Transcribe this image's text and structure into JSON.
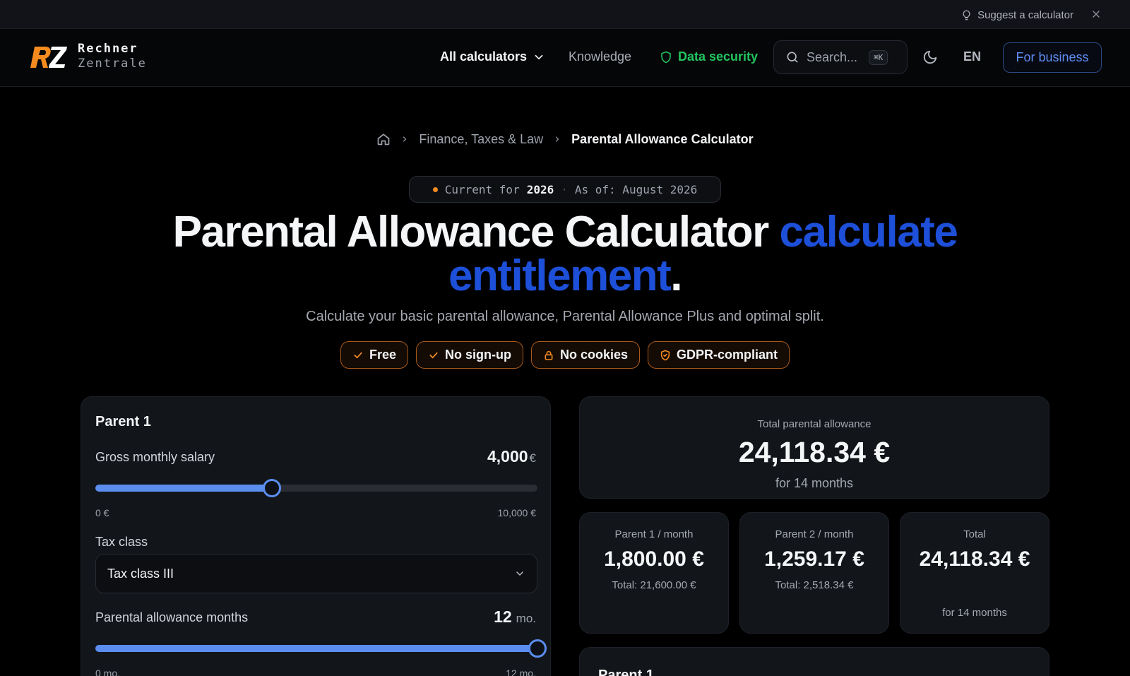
{
  "topbar": {
    "suggest_label": "Suggest a calculator"
  },
  "header": {
    "logo_line1": "Rechner",
    "logo_line2": "Zentrale",
    "nav": {
      "all_calculators": "All calculators",
      "knowledge": "Knowledge",
      "data_security": "Data security"
    },
    "search_placeholder": "Search...",
    "search_shortcut": "⌘K",
    "language": "EN",
    "business_button": "For business"
  },
  "breadcrumb": {
    "category": "Finance, Taxes & Law",
    "current": "Parental Allowance Calculator"
  },
  "hero": {
    "badge_prefix": "Current for",
    "badge_year": "2026",
    "badge_separator": "·",
    "badge_asof": "As of: August 2026",
    "title_main": "Parental Allowance Calculator",
    "title_accent_1": "calculate",
    "title_accent_2": "entitlement",
    "title_end": ".",
    "subtitle": "Calculate your basic parental allowance, Parental Allowance Plus and optimal split.",
    "pills": [
      "Free",
      "No sign-up",
      "No cookies",
      "GDPR-compliant"
    ]
  },
  "parent_card": {
    "title": "Parent 1",
    "salary": {
      "label": "Gross monthly salary",
      "value": "4,000",
      "unit": "€",
      "min_label": "0 €",
      "max_label": "10,000 €",
      "fraction": 0.4
    },
    "tax_class": {
      "label": "Tax class",
      "value": "Tax class III"
    },
    "months": {
      "label": "Parental allowance months",
      "value": "12",
      "unit": "mo.",
      "min_label": "0 mo.",
      "max_label": "12 mo.",
      "fraction": 1.0
    }
  },
  "results": {
    "total": {
      "label": "Total parental allowance",
      "value": "24,118.34 €",
      "sub": "for 14 months"
    },
    "parent1": {
      "label": "Parent 1 / month",
      "value": "1,800.00 €",
      "sub": "Total: 21,600.00 €"
    },
    "parent2": {
      "label": "Parent 2 / month",
      "value": "1,259.17 €",
      "sub": "Total: 2,518.34 €"
    },
    "combined": {
      "label": "Total",
      "value": "24,118.34 €",
      "sub": "for 14 months"
    },
    "next_card_title": "Parent 1"
  },
  "colors": {
    "accent_blue": "#1d4fd8",
    "slider_blue": "#5b8def",
    "security_green": "#22c55e",
    "brand_orange": "#f58b1f"
  },
  "icons": {
    "suggest": "lightbulb-icon",
    "close": "close-icon",
    "chevron": "chevron-down-icon",
    "security": "shield-icon",
    "search": "search-icon",
    "theme": "moon-icon",
    "home": "home-icon",
    "check": "check-icon",
    "lock": "lock-icon",
    "shield_check": "shield-check-icon"
  }
}
